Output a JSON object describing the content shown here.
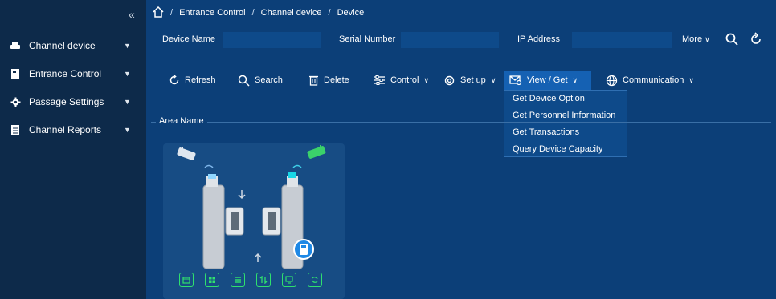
{
  "sidebar": {
    "collapse_glyph": "«",
    "items": [
      {
        "label": "Channel device",
        "icon": "channel-device-icon"
      },
      {
        "label": "Entrance Control",
        "icon": "entrance-control-icon"
      },
      {
        "label": "Passage Settings",
        "icon": "gear-icon"
      },
      {
        "label": "Channel Reports",
        "icon": "report-icon"
      }
    ]
  },
  "breadcrumb": {
    "items": [
      "Entrance Control",
      "Channel device",
      "Device"
    ],
    "separator": "/"
  },
  "search": {
    "device_name_label": "Device Name",
    "serial_number_label": "Serial Number",
    "ip_address_label": "IP Address",
    "more_label": "More"
  },
  "toolbar": {
    "refresh_label": "Refresh",
    "search_label": "Search",
    "delete_label": "Delete",
    "control_label": "Control",
    "setup_label": "Set up",
    "viewget_label": "View / Get",
    "communication_label": "Communication"
  },
  "viewget_menu": {
    "items": [
      "Get Device Option",
      "Get Personnel Information",
      "Get Transactions",
      "Query Device Capacity"
    ]
  },
  "area": {
    "title": "Area Name"
  },
  "colors": {
    "sidebar_bg": "#0d2a4a",
    "main_bg": "#0c3f78",
    "accent": "#1561b3",
    "status_green": "#2fe06e"
  }
}
